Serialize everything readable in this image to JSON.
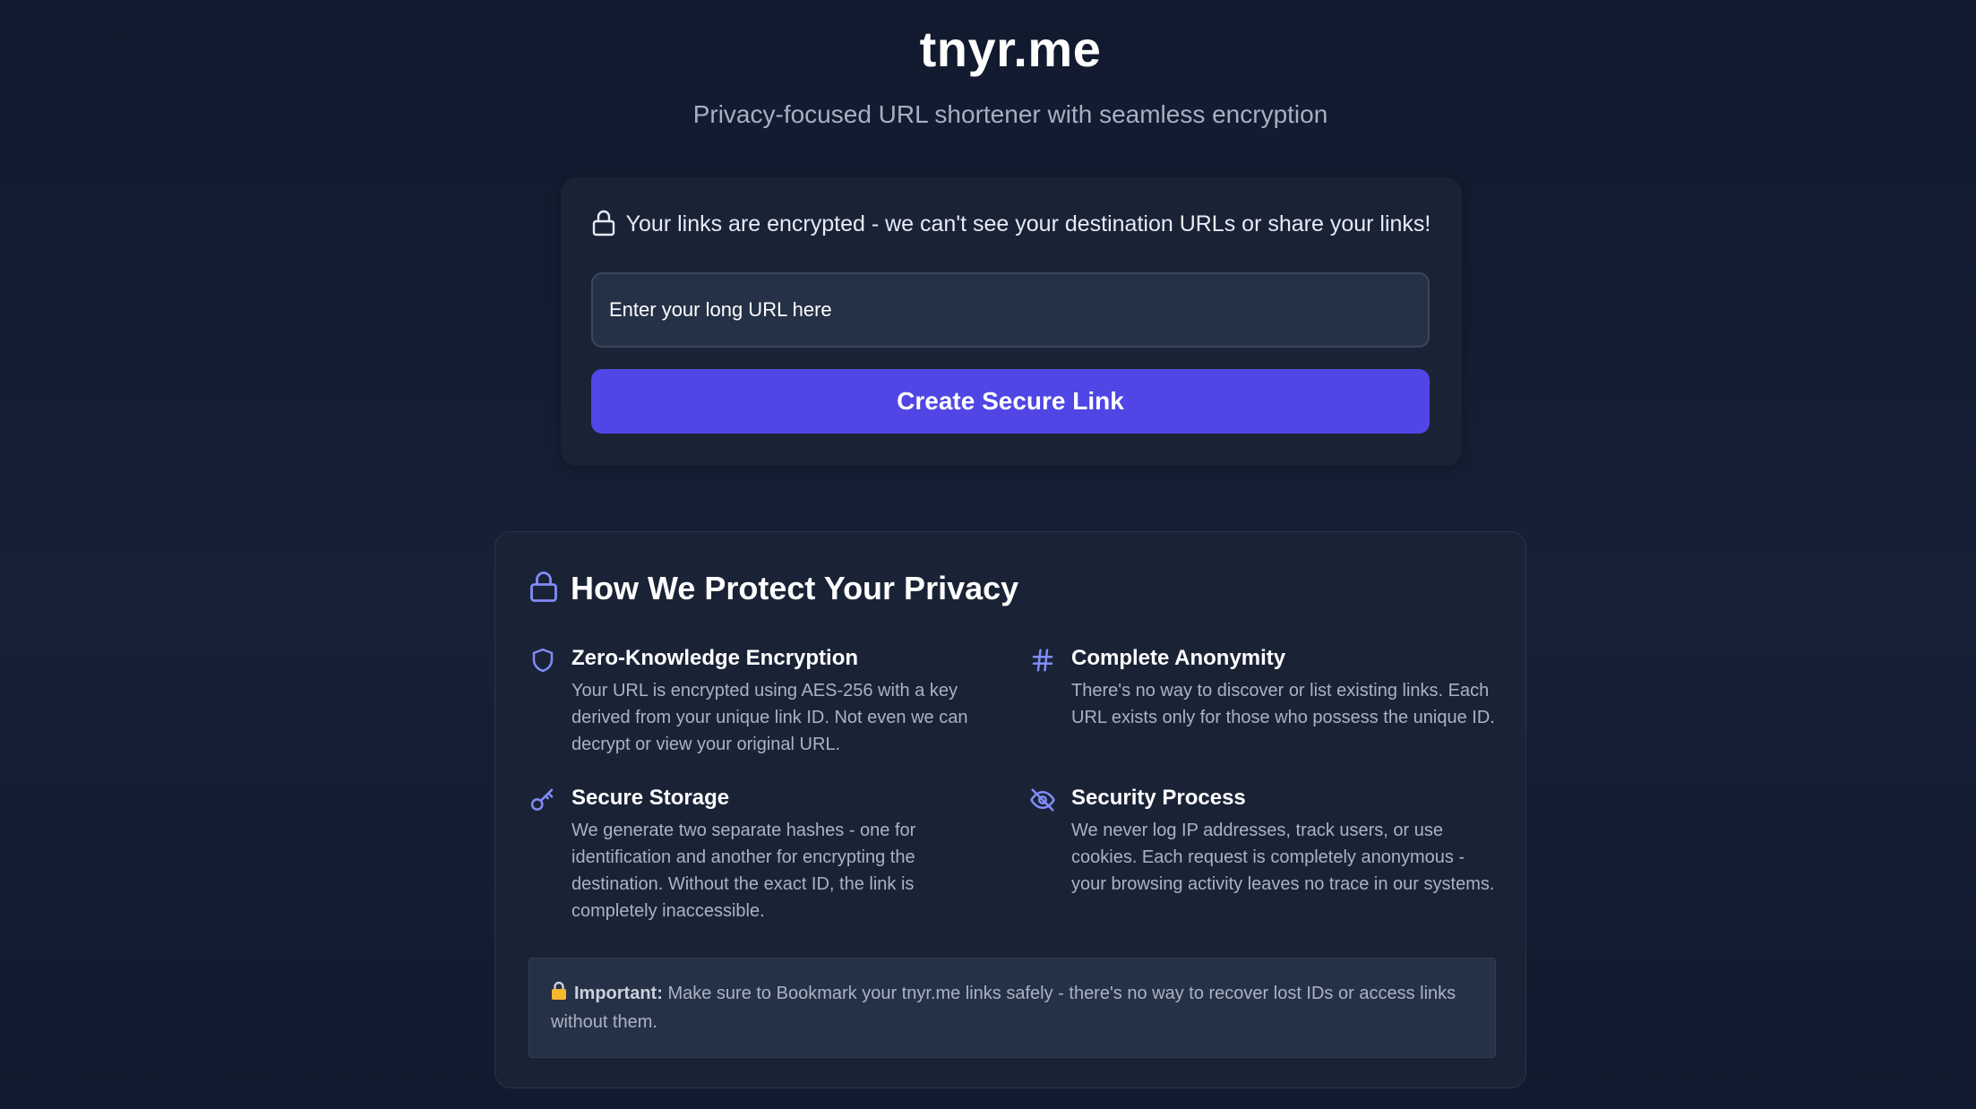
{
  "header": {
    "title": "tnyr.me",
    "subtitle": "Privacy-focused URL shortener with seamless encryption"
  },
  "shortener": {
    "notice": "Your links are encrypted - we can't see your destination URLs or share your links!",
    "input_placeholder": "Enter your long URL here",
    "input_value": "",
    "button_label": "Create Secure Link"
  },
  "privacy": {
    "heading": "How We Protect Your Privacy",
    "features": [
      {
        "icon": "shield-icon",
        "title": "Zero-Knowledge Encryption",
        "description": "Your URL is encrypted using AES-256 with a key derived from your unique link ID. Not even we can decrypt or view your original URL."
      },
      {
        "icon": "hash-icon",
        "title": "Complete Anonymity",
        "description": "There's no way to discover or list existing links. Each URL exists only for those who possess the unique ID."
      },
      {
        "icon": "key-icon",
        "title": "Secure Storage",
        "description": "We generate two separate hashes - one for identification and another for encrypting the destination. Without the exact ID, the link is completely inaccessible."
      },
      {
        "icon": "eye-off-icon",
        "title": "Security Process",
        "description": "We never log IP addresses, track users, or use cookies. Each request is completely anonymous - your browsing activity leaves no trace in our systems."
      }
    ],
    "important": {
      "label": "Important:",
      "text": "Make sure to Bookmark your tnyr.me links safely - there's no way to recover lost IDs or access links without them."
    }
  },
  "colors": {
    "accent": "#4f46e5",
    "icon_accent": "#818cf8",
    "background": "#141d31",
    "card": "#1a2336"
  }
}
